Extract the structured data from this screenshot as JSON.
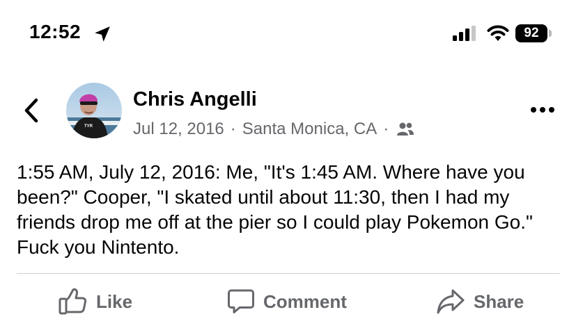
{
  "status_bar": {
    "time": "12:52",
    "battery": "92",
    "icons": [
      "location-arrow-icon",
      "signal-icon",
      "wifi-icon",
      "battery-icon"
    ]
  },
  "post": {
    "author": "Chris Angelli",
    "date": "Jul 12, 2016",
    "location": "Santa Monica, CA",
    "separator": "·",
    "audience_icon": "friends-icon",
    "text": "1:55 AM, July 12, 2016: Me, \"It's 1:45 AM. Where have you been?\" Cooper, \"I skated until about 11:30, then I had my friends drop me off at the pier so I could play Pokemon Go.\" Fuck you Nintento."
  },
  "actions": {
    "like": "Like",
    "comment": "Comment",
    "share": "Share"
  },
  "colors": {
    "text_primary": "#050505",
    "text_secondary": "#65676b",
    "divider": "#ced0d4"
  }
}
